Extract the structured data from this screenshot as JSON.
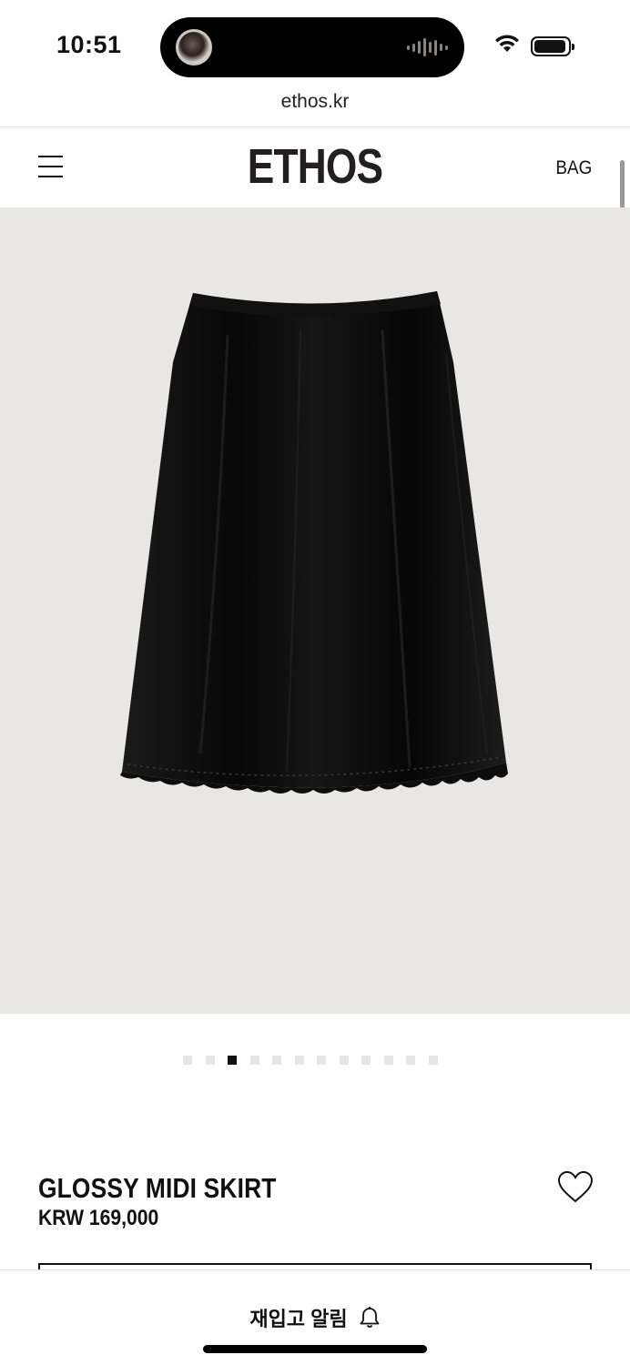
{
  "status_bar": {
    "time": "10:51"
  },
  "browser": {
    "url": "ethos.kr"
  },
  "header": {
    "logo": "ETHOS",
    "bag_label": "BAG",
    "menu_icon": "hamburger-menu-icon"
  },
  "product": {
    "image_description": "black-glossy-midi-skirt-with-lace-hem",
    "carousel": {
      "total": 12,
      "active_index": 2
    },
    "name": "GLOSSY MIDI SKIRT",
    "price": "KRW 169,000",
    "wishlist_icon": "heart-outline-icon"
  },
  "bottom_bar": {
    "restock_label": "재입고 알림",
    "bell_icon": "bell-icon"
  },
  "colors": {
    "image_background": "#e9e7e4",
    "text": "#111111",
    "dot_inactive": "#e6e6e6",
    "dot_active": "#111111"
  }
}
